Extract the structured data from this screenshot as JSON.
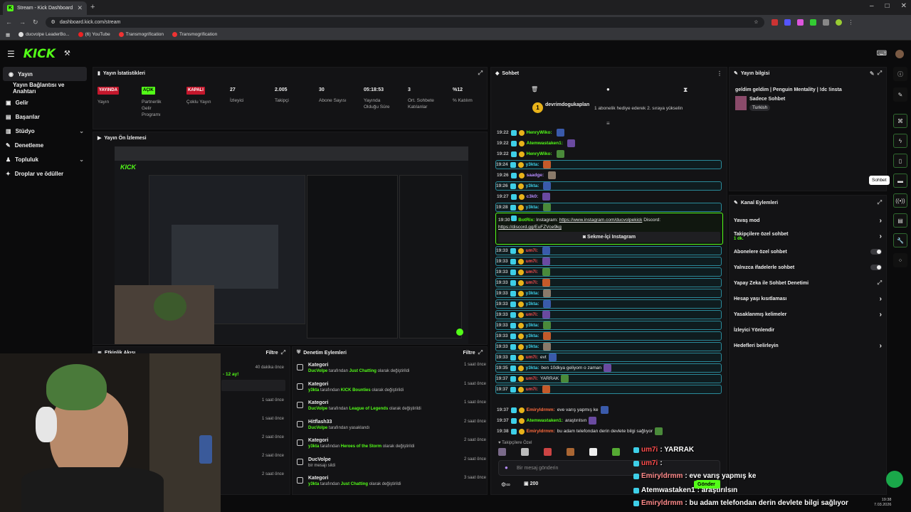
{
  "browser": {
    "tab_title": "Stream - Kick Dashboard",
    "url": "dashboard.kick.com/stream",
    "bookmarks": [
      "ducvolpe LeaderBo...",
      "(6) YouTube",
      "Transmogrification",
      "Transmogrification"
    ]
  },
  "sidebar": {
    "items": [
      {
        "label": "Yayın",
        "active": true
      },
      {
        "label": "Yayın Bağlantısı ve Anahtarı"
      },
      {
        "label": "Gelir"
      },
      {
        "label": "Başarılar"
      },
      {
        "label": "Stüdyo"
      },
      {
        "label": "Denetleme"
      },
      {
        "label": "Topluluk"
      },
      {
        "label": "Droplar ve ödüller"
      }
    ]
  },
  "stats": {
    "title": "Yayın İstatistikleri",
    "items": [
      {
        "value": "YAYINDA",
        "label": "Yayın",
        "badge": "#c3172c"
      },
      {
        "value": "AÇIK",
        "label": "Partnerlik Gelir Programı",
        "badge": "#53fc18"
      },
      {
        "value": "KAPALI",
        "label": "Çoklu Yayın",
        "badge": "#c3172c"
      },
      {
        "value": "27",
        "label": "İzleyici"
      },
      {
        "value": "2.005",
        "label": "Takipçi"
      },
      {
        "value": "30",
        "label": "Abone Sayısı"
      },
      {
        "value": "05:18:53",
        "label": "Yayında Olduğu Süre"
      },
      {
        "value": "3",
        "label": "Ort. Sohbete Katılanlar"
      },
      {
        "value": "%12",
        "label": "% Katılım"
      }
    ]
  },
  "preview": {
    "title": "Yayın Ön İzlemesi"
  },
  "activity": {
    "title": "Etkinlik Akışı",
    "filter": "Filtre",
    "times": [
      "40 dakika önce",
      "1 saat önce",
      "1 saat önce",
      "2 saat önce",
      "2 saat önce",
      "2 saat önce"
    ],
    "snippet": "- 12 ay!"
  },
  "moderation": {
    "title": "Denetim Eylemleri",
    "filter": "Filtre",
    "rows": [
      {
        "title": "Kategori",
        "user": "DucVolpe",
        "mid": "tarafından",
        "target": "Just Chatting",
        "end": "olarak değiştirildi",
        "time": "1 saat önce"
      },
      {
        "title": "Kategori",
        "user": "y3kta",
        "mid": "tarafından",
        "target": "KICK Bounties",
        "end": "olarak değiştirildi",
        "time": "1 saat önce"
      },
      {
        "title": "Kategori",
        "user": "DucVolpe",
        "mid": "tarafından",
        "target": "League of Legends",
        "end": "olarak değiştirildi",
        "time": "1 saat önce"
      },
      {
        "title": "Hitflash33",
        "user": "DucVolpe",
        "mid": "tarafından yasaklandı",
        "target": "",
        "end": "",
        "time": "2 saat önce"
      },
      {
        "title": "Kategori",
        "user": "y3kta",
        "mid": "tarafından",
        "target": "Heroes of the Storm",
        "end": "olarak değiştirildi",
        "time": "2 saat önce"
      },
      {
        "title": "DucVolpe",
        "user": "",
        "mid": "bir mesajı sildi",
        "target": "",
        "end": "",
        "time": "2 saat önce"
      },
      {
        "title": "Kategori",
        "user": "y3kta",
        "mid": "tarafından",
        "target": "Just Chatting",
        "end": "olarak değiştirildi",
        "time": "3 saat önce"
      }
    ]
  },
  "chat": {
    "title": "Sohbet",
    "pinned_user": "devrimdogukaplan",
    "pinned_count": "1",
    "pinned_text": "1 abonelik hediye ederek 2. sıraya yükselin",
    "messages": [
      {
        "time": "19:22",
        "user": "HenryWiko:",
        "color": "#53fc18",
        "text": ""
      },
      {
        "time": "19:22",
        "user": "Atemwastaken1:",
        "color": "#53fc18",
        "text": ""
      },
      {
        "time": "19:22",
        "user": "HenryWiko:",
        "color": "#53fc18",
        "text": ""
      },
      {
        "time": "19:24",
        "user": "y3kta:",
        "color": "#3ecfe8",
        "text": "",
        "hl": true
      },
      {
        "time": "19:26",
        "user": "saadge:",
        "color": "#b78cff",
        "text": ""
      },
      {
        "time": "19:26",
        "user": "y3kta:",
        "color": "#3ecfe8",
        "text": "",
        "hl": true
      },
      {
        "time": "19:27",
        "user": "c3k0:",
        "color": "#b78cff",
        "text": ""
      },
      {
        "time": "19:28",
        "user": "y3kta:",
        "color": "#3ecfe8",
        "text": "",
        "hl": true
      }
    ],
    "bot_time": "19:30",
    "bot_user": "BotRix:",
    "bot_text1": "Instagram:",
    "bot_link": "https://www.instagram.com/ducvolpekick",
    "bot_text2": "Discord:",
    "bot_link2": "https://discord.gg/EuFZVce9kg",
    "bot_button": "Sekme-İçi Instagram",
    "messages2": [
      {
        "time": "19:33",
        "user": "um7i:",
        "color": "#ff4d4d",
        "text": ""
      },
      {
        "time": "19:33",
        "user": "um7i:",
        "color": "#ff4d4d",
        "text": ""
      },
      {
        "time": "19:33",
        "user": "um7i:",
        "color": "#ff4d4d",
        "text": ""
      },
      {
        "time": "19:33",
        "user": "um7i:",
        "color": "#ff4d4d",
        "text": ""
      },
      {
        "time": "19:33",
        "user": "y3kta:",
        "color": "#3ecfe8",
        "text": ""
      },
      {
        "time": "19:33",
        "user": "y3kta:",
        "color": "#3ecfe8",
        "text": ""
      },
      {
        "time": "19:33",
        "user": "um7i:",
        "color": "#ff4d4d",
        "text": ""
      },
      {
        "time": "19:33",
        "user": "y3kta:",
        "color": "#3ecfe8",
        "text": ""
      },
      {
        "time": "19:33",
        "user": "y3kta:",
        "color": "#3ecfe8",
        "text": ""
      },
      {
        "time": "19:33",
        "user": "y3kta:",
        "color": "#3ecfe8",
        "text": ""
      },
      {
        "time": "19:33",
        "user": "um7i:",
        "color": "#ff4d4d",
        "text": "evt"
      },
      {
        "time": "19:35",
        "user": "y3kta:",
        "color": "#3ecfe8",
        "text": "ben 10dkya geliyom o zaman"
      },
      {
        "time": "19:37",
        "user": "um7i:",
        "color": "#ff4d4d",
        "text": "YARRAK"
      },
      {
        "time": "19:37",
        "user": "um7i:",
        "color": "#ff4d4d",
        "text": ""
      }
    ],
    "messages3": [
      {
        "time": "19:37",
        "user": "Emiryldrmm:",
        "color": "#ff6b3d",
        "text": "eve varış yapmış ke"
      },
      {
        "time": "19:37",
        "user": "Atemwastaken1:",
        "color": "#53fc18",
        "text": "araştırılsın"
      },
      {
        "time": "19:38",
        "user": "Emiryldrmm:",
        "color": "#ff6b3d",
        "text": "bu adam telefondan derin devlete bilgi sağlıyor"
      }
    ],
    "followers_label": "Takipçilere Özel",
    "input_placeholder": "Bir mesaj gönderin",
    "send_label": "Gönder",
    "points": "200"
  },
  "stream_info": {
    "title": "Yayın bilgisi",
    "stream_title": "geldim geldim | Penguin Mentality | !dc !insta",
    "category": "Sadece Sohbet",
    "tag": "Turkish"
  },
  "channel_actions": {
    "title": "Kanal Eylemleri",
    "items": [
      {
        "label": "Yavaş mod",
        "type": "chevron"
      },
      {
        "label": "Takipçilere özel sohbet",
        "sub": "1 dk.",
        "type": "chevron"
      },
      {
        "label": "Abonelere özel sohbet",
        "type": "toggle"
      },
      {
        "label": "Yalnızca ifadelerle sohbet",
        "type": "toggle"
      },
      {
        "label": "Yapay Zeka ile Sohbet Denetimi",
        "type": "ext"
      },
      {
        "label": "Hesap yaşı kısıtlaması",
        "type": "chevron"
      },
      {
        "label": "Yasaklanmış kelimeler",
        "type": "chevron"
      },
      {
        "label": "İzleyici Yönlendir",
        "type": "none"
      },
      {
        "label": "Hedefleri belirleyin",
        "type": "chevron"
      }
    ]
  },
  "tooltip": "Sohbet",
  "overlay_chat": [
    {
      "user": "um7i",
      "text": ": YARRAK",
      "color": "#ff4d4d"
    },
    {
      "user": "um7i",
      "text": ":",
      "color": "#ff4d4d"
    },
    {
      "user": "Emiryldrmm",
      "text": ": eve varış yapmış ke",
      "color": "#ff8a8a"
    },
    {
      "user": "Atemwastaken1",
      "text": ": araştırılsın",
      "color": "#ffffff"
    },
    {
      "user": "Emiryldrmm",
      "text": ": bu adam telefondan derin devlete bilgi sağlıyor",
      "color": "#ff8a8a"
    }
  ],
  "taskbar": {
    "time": "19:38",
    "date": "7.03.2026"
  },
  "colors": {
    "accent": "#53fc18",
    "live": "#c3172c",
    "mod": "#3ecfe8"
  }
}
